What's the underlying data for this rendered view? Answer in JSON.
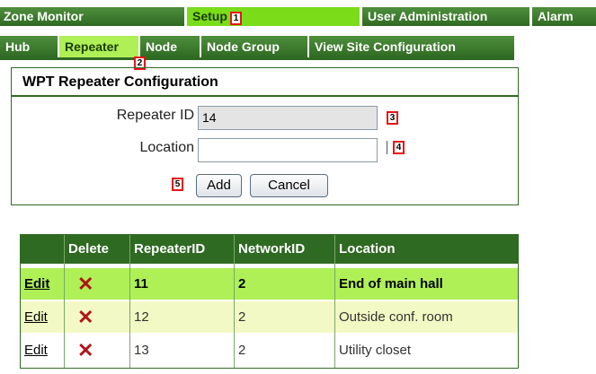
{
  "top_nav": {
    "items": [
      "Zone Monitor",
      "Setup",
      "User Administration",
      "Alarm"
    ]
  },
  "sub_nav": {
    "items": [
      "Hub",
      "Repeater",
      "Node",
      "Node Group",
      "View Site Configuration"
    ]
  },
  "markers": [
    "1",
    "2",
    "3",
    "4",
    "5"
  ],
  "form": {
    "title": "WPT Repeater Configuration",
    "repeater_id_label": "Repeater ID",
    "repeater_id_value": "14",
    "location_label": "Location",
    "location_value": "",
    "add_label": "Add",
    "cancel_label": "Cancel"
  },
  "table": {
    "headers": [
      "",
      "Delete",
      "RepeaterID",
      "NetworkID",
      "Location"
    ],
    "edit_label": "Edit",
    "delete_icon": "delete-x-icon",
    "rows": [
      {
        "repeater_id": "11",
        "network_id": "2",
        "location": "End of main hall",
        "highlight": true
      },
      {
        "repeater_id": "12",
        "network_id": "2",
        "location": "Outside conf. room",
        "highlight": false
      },
      {
        "repeater_id": "13",
        "network_id": "2",
        "location": "Utility closet",
        "highlight": false
      }
    ]
  },
  "colors": {
    "nav_green": "#2f6a22",
    "setup_green": "#7bdc1a",
    "active_tab": "#aef055",
    "row_highlight": "#aef055",
    "row_alt": "#f3f9c4",
    "marker_red": "#e8141a"
  }
}
